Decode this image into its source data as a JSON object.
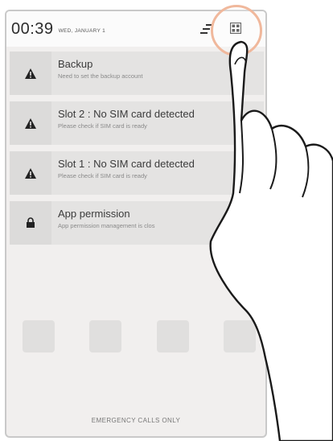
{
  "status_bar": {
    "time": "00:39",
    "date": "WED, JANUARY 1"
  },
  "notifications": [
    {
      "icon": "warning-icon",
      "title": "Backup",
      "subtitle": "Need to set the backup account"
    },
    {
      "icon": "warning-icon",
      "title": "Slot 2 : No SIM card detected",
      "subtitle": "Please check if SIM card is ready"
    },
    {
      "icon": "warning-icon",
      "title": "Slot 1 : No SIM card detected",
      "subtitle": "Please check if SIM card is ready"
    },
    {
      "icon": "lock-icon",
      "title": "App permission",
      "subtitle": "App permission management is clos"
    }
  ],
  "footer": {
    "emergency_text": "EMERGENCY CALLS ONLY"
  },
  "colors": {
    "highlight_ring": "#f0b89c",
    "notification_bg": "#e4e3e2"
  }
}
